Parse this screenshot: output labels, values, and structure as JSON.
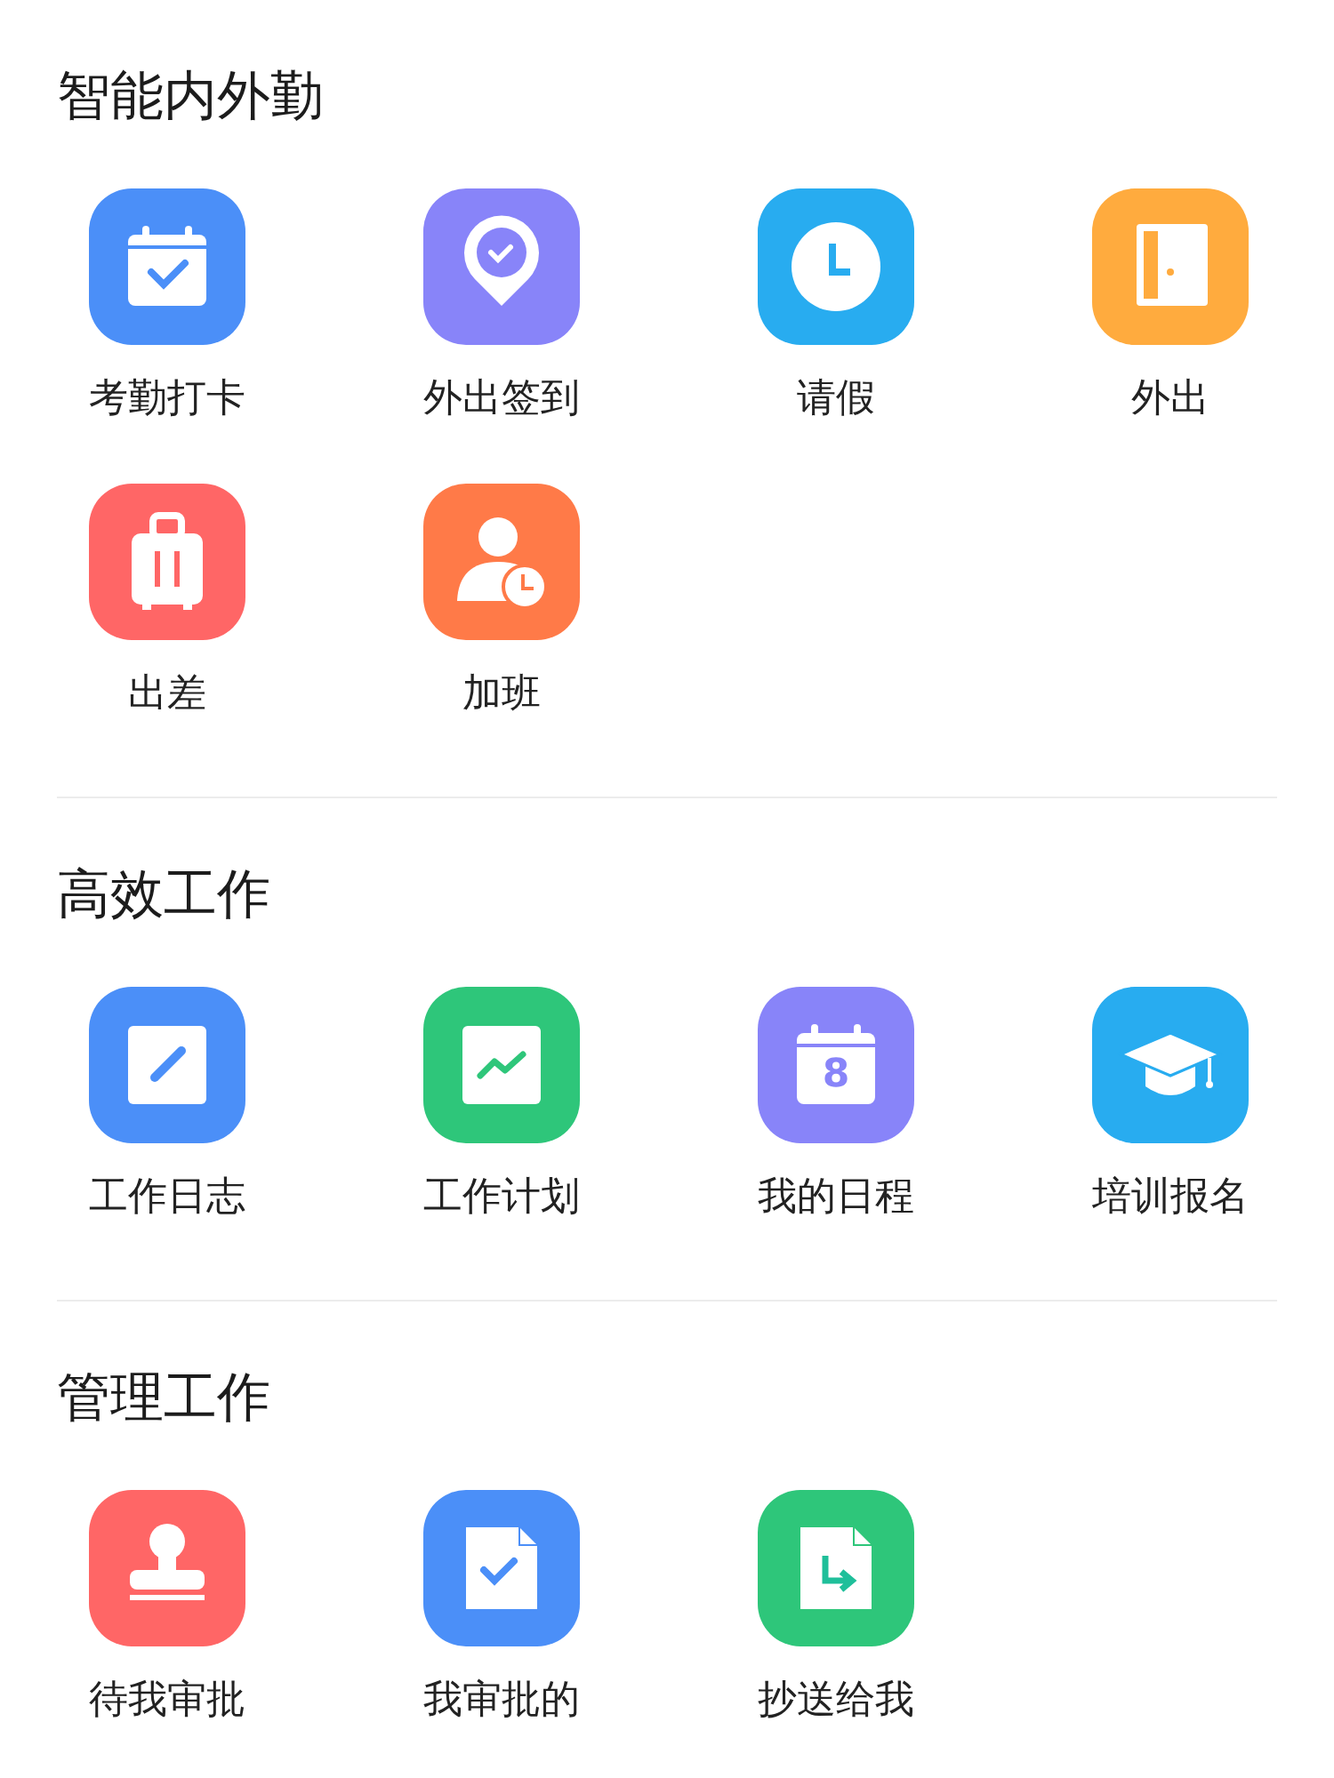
{
  "sections": [
    {
      "title": "智能内外勤",
      "items": [
        {
          "label": "考勤打卡",
          "kind": "calendar-check",
          "color": "#4b8ff8"
        },
        {
          "label": "外出签到",
          "kind": "pin-check",
          "color": "#8884f9"
        },
        {
          "label": "请假",
          "kind": "clock",
          "color": "#28acf0"
        },
        {
          "label": "外出",
          "kind": "door",
          "color": "#ffab3e"
        },
        {
          "label": "出差",
          "kind": "suitcase",
          "color": "#ff6666"
        },
        {
          "label": "加班",
          "kind": "person-clock",
          "color": "#ff7a48"
        }
      ]
    },
    {
      "title": "高效工作",
      "items": [
        {
          "label": "工作日志",
          "kind": "pencil-note",
          "color": "#4b8ff8"
        },
        {
          "label": "工作计划",
          "kind": "chart-note",
          "color": "#2ec67a"
        },
        {
          "label": "我的日程",
          "kind": "calendar-number",
          "glyph": "8",
          "color": "#8884f9"
        },
        {
          "label": "培训报名",
          "kind": "graduation-cap",
          "color": "#28acf0"
        }
      ]
    },
    {
      "title": "管理工作",
      "items": [
        {
          "label": "待我审批",
          "kind": "stamp",
          "color": "#ff6666"
        },
        {
          "label": "我审批的",
          "kind": "doc-check",
          "color": "#4b8ff8"
        },
        {
          "label": "抄送给我",
          "kind": "doc-arrow",
          "color": "#2ec67a"
        }
      ]
    }
  ]
}
